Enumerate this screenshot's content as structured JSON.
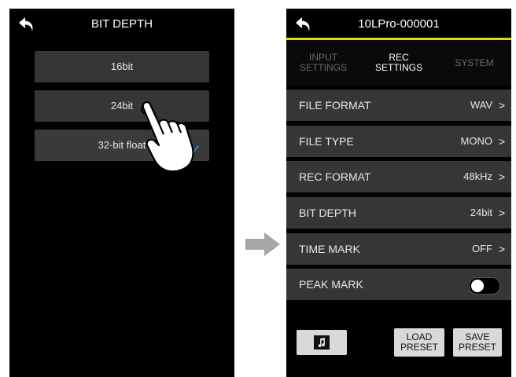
{
  "left_screen": {
    "title": "BIT DEPTH",
    "options": [
      "16bit",
      "24bit",
      "32-bit float"
    ],
    "checkmark": "✓"
  },
  "right_screen": {
    "title": "10LPro-000001",
    "tabs": [
      {
        "label_line1": "INPUT",
        "label_line2": "SETTINGS",
        "active": false
      },
      {
        "label_line1": "REC",
        "label_line2": "SETTINGS",
        "active": true
      },
      {
        "label_line1": "SYSTEM",
        "label_line2": "",
        "active": false
      }
    ],
    "rows": [
      {
        "label": "FILE FORMAT",
        "value": "WAV"
      },
      {
        "label": "FILE TYPE",
        "value": "MONO"
      },
      {
        "label": "REC FORMAT",
        "value": "48kHz"
      },
      {
        "label": "BIT DEPTH",
        "value": "24bit"
      },
      {
        "label": "TIME MARK",
        "value": "OFF"
      },
      {
        "label": "PEAK MARK",
        "value": ""
      }
    ],
    "chevron": ">",
    "load_preset": {
      "line1": "LOAD",
      "line2": "PRESET"
    },
    "save_preset": {
      "line1": "SAVE",
      "line2": "PRESET"
    }
  },
  "colors": {
    "accent_yellow": "#e7d31b",
    "check_blue": "#1e90ff",
    "arrow_gray": "#a6a6a6"
  },
  "icons": [
    "back-arrow-icon",
    "music-note-icon",
    "hand-pointer-icon",
    "right-arrow-icon"
  ]
}
